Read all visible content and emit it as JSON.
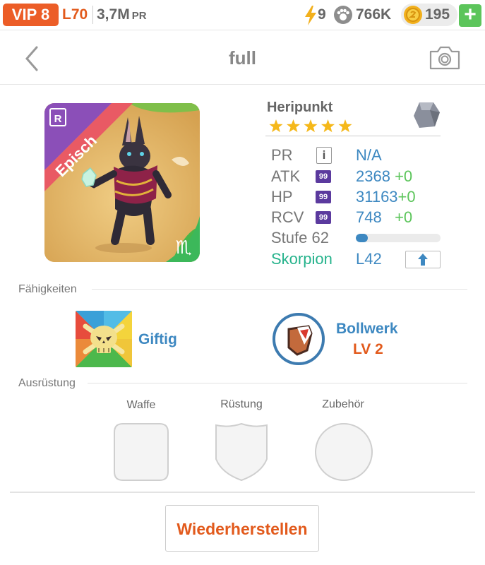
{
  "statusbar": {
    "vip": "VIP 8",
    "level": "L70",
    "power": "3,7M",
    "power_unit": "PR",
    "energy": "9",
    "paws": "766K",
    "coins": "195",
    "add": "+"
  },
  "nav": {
    "title": "full"
  },
  "pet": {
    "rarity": "Episch",
    "rarity_badge": "R",
    "name": "Heripunkt",
    "stars": 5,
    "stats": {
      "pr_label": "PR",
      "pr_value": "N/A",
      "atk_label": "ATK",
      "atk_value": "2368",
      "atk_gain": "+0",
      "hp_label": "HP",
      "hp_value": "31163",
      "hp_gain": "+0",
      "rcv_label": "RCV",
      "rcv_value": "748",
      "rcv_gain": "+0",
      "badge": "99",
      "info": "i"
    },
    "level_label": "Stufe 62",
    "level_progress": 0.14,
    "sign_label": "Skorpion",
    "sign_level": "L42"
  },
  "skills": {
    "heading": "Fähigkeiten",
    "items": [
      {
        "name": "Giftig"
      },
      {
        "name": "Bollwerk",
        "level": "LV 2"
      }
    ]
  },
  "equipment": {
    "heading": "Ausrüstung",
    "slots": [
      "Waffe",
      "Rüstung",
      "Zubehör"
    ]
  },
  "actions": {
    "restore": "Wiederherstellen"
  },
  "colors": {
    "accent_orange": "#ec5d27",
    "blue": "#3d88c1",
    "green": "#5cc55b",
    "teal": "#26b38c",
    "purple_badge": "#5b3a9e"
  },
  "icons": {
    "energy": "lightning-icon",
    "paws": "paw-icon",
    "coins": "coin-icon",
    "back": "chevron-left-icon",
    "camera": "camera-icon",
    "element": "stone-element-icon",
    "upgrade": "arrow-up-icon",
    "sign": "scorpio-icon"
  }
}
